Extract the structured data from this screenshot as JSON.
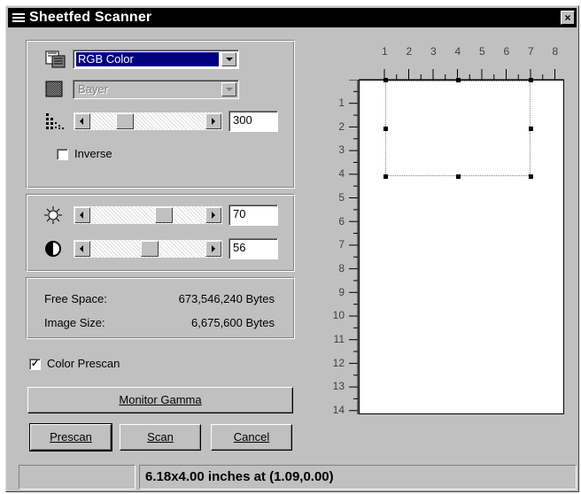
{
  "window": {
    "title": "Sheetfed Scanner",
    "close_glyph": "×"
  },
  "image_settings": {
    "color_mode": {
      "value": "RGB Color",
      "icon": "color-mode-icon"
    },
    "halftone": {
      "value": "Bayer",
      "icon": "halftone-pattern-icon"
    },
    "resolution": {
      "value": "300",
      "icon": "resolution-icon"
    },
    "inverse_label": "Inverse",
    "inverse_checked": false
  },
  "adjust": {
    "brightness": {
      "value": "70",
      "icon": "brightness-icon"
    },
    "contrast": {
      "value": "56",
      "icon": "contrast-icon"
    }
  },
  "info": {
    "free_space_label": "Free Space:",
    "free_space_value": "673,546,240 Bytes",
    "image_size_label": "Image Size:",
    "image_size_value": "6,675,600 Bytes"
  },
  "color_prescan_label": "Color Prescan",
  "color_prescan_checked": true,
  "buttons": {
    "monitor_gamma": "Monitor Gamma",
    "prescan": "Prescan",
    "scan": "Scan",
    "cancel": "Cancel"
  },
  "ruler": {
    "top_numbers": [
      "1",
      "2",
      "3",
      "4",
      "5",
      "6",
      "7",
      "8"
    ],
    "left_numbers": [
      "1",
      "2",
      "3",
      "4",
      "5",
      "6",
      "7",
      "8",
      "9",
      "10",
      "11",
      "12",
      "13",
      "14"
    ]
  },
  "status": {
    "text": "6.18x4.00 inches at (1.09,0.00)"
  }
}
